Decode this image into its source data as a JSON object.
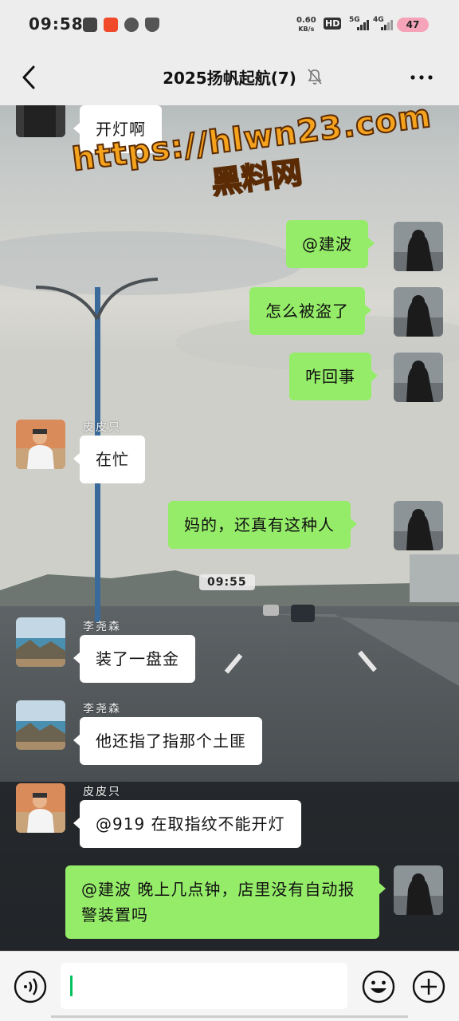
{
  "status_bar": {
    "time": "09:58",
    "net_speed_value": "0.60",
    "net_speed_unit": "KB/s",
    "hd_label": "HD",
    "signal_1": "5G",
    "signal_2": "4G",
    "battery": "47"
  },
  "header": {
    "title": "2025扬帆起航(7)",
    "icons": [
      "back-arrow-icon",
      "mute-bell-icon",
      "more-dots-icon"
    ]
  },
  "watermark": {
    "url": "https://hlwn23.com",
    "name": "黑料网"
  },
  "messages": [
    {
      "side": "in",
      "sender": "",
      "text": "开灯啊"
    },
    {
      "side": "out",
      "text": "@建波"
    },
    {
      "side": "out",
      "text": "怎么被盗了"
    },
    {
      "side": "out",
      "text": "咋回事"
    },
    {
      "side": "in",
      "sender": "皮皮只",
      "text": "在忙"
    },
    {
      "side": "out",
      "text": "妈的，还真有这种人"
    },
    {
      "side": "time",
      "text": "09:55"
    },
    {
      "side": "in",
      "sender": "李尧森",
      "text": "装了一盘金"
    },
    {
      "side": "in",
      "sender": "李尧森",
      "text": "他还指了指那个土匪"
    },
    {
      "side": "in",
      "sender": "皮皮只",
      "text": "@919  在取指纹不能开灯"
    },
    {
      "side": "out",
      "text": "@建波  晚上几点钟，店里没有自动报警装置吗"
    }
  ],
  "input_bar": {
    "value": "",
    "icons": [
      "voice-icon",
      "emoji-icon",
      "plus-icon"
    ]
  },
  "colors": {
    "outgoing_bubble": "#95ec69",
    "incoming_bubble": "#ffffff",
    "header_bg": "#ededed",
    "battery_bg": "#f4a3b8",
    "cursor": "#07c160"
  }
}
